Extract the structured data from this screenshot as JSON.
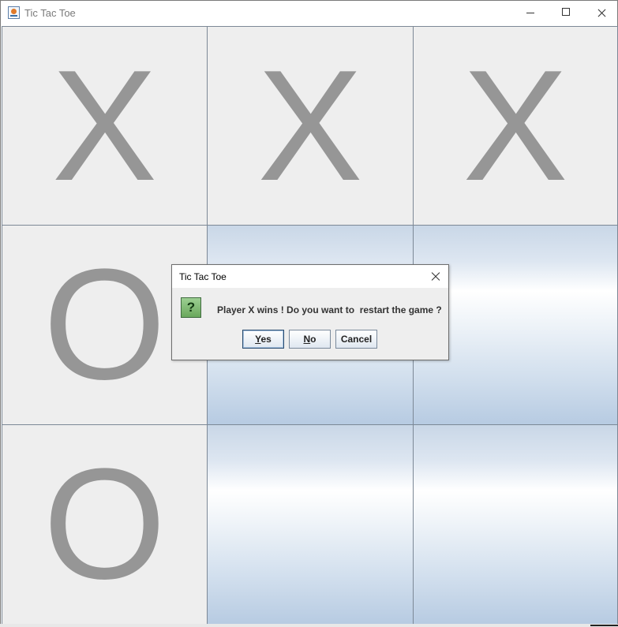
{
  "window": {
    "title": "Tic Tac Toe",
    "icons": [
      "java-app-icon",
      "minimize-icon",
      "maximize-icon",
      "close-icon"
    ]
  },
  "board": {
    "cells": [
      "X",
      "X",
      "X",
      "O",
      "",
      "",
      "O",
      "",
      ""
    ]
  },
  "dialog": {
    "title": "Tic Tac Toe",
    "icon": "question-icon",
    "icon_glyph": "?",
    "message": "Player X wins ! Do you want to  restart the game ?",
    "buttons": {
      "yes": "Yes",
      "no": "No",
      "cancel": "Cancel"
    }
  },
  "colors": {
    "mark": "#969696",
    "filled_cell": "#eeeeee",
    "empty_cell_gradient": [
      "#c9d7e7",
      "#ffffff",
      "#b7cbe2"
    ],
    "question_icon": "#7ab86c"
  }
}
